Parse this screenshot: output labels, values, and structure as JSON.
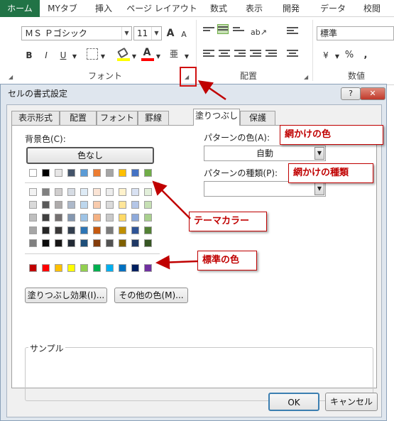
{
  "ribbon": {
    "tabs": [
      {
        "label": "ホーム",
        "active": true
      },
      {
        "label": "MYタブ"
      },
      {
        "label": "挿入"
      },
      {
        "label": "ページ レイアウト"
      },
      {
        "label": "数式"
      },
      {
        "label": "表示"
      },
      {
        "label": "開発"
      },
      {
        "label": "データ"
      },
      {
        "label": "校閲"
      }
    ],
    "font_name": "ＭＳ Ｐゴシック",
    "font_size": "11",
    "number_format": "標準",
    "groups": {
      "font": "フォント",
      "alignment": "配置",
      "number": "数値"
    },
    "buttons": {
      "bold": "B",
      "italic": "I",
      "underline": "U",
      "grow_font": "A",
      "shrink_font": "A",
      "font_color": "A",
      "percent": "%",
      "comma": ",",
      "phonetic": "亜"
    }
  },
  "dialog": {
    "title": "セルの書式設定",
    "help": "?",
    "close": "✕",
    "tabs": [
      "表示形式",
      "配置",
      "フォント",
      "罫線",
      "塗りつぶし",
      "保護"
    ],
    "active_tab": "塗りつぶし",
    "background_color_label": "背景色(C):",
    "no_color_button": "色なし",
    "pattern_color_label": "パターンの色(A):",
    "pattern_color_value": "自動",
    "pattern_style_label": "パターンの種類(P):",
    "pattern_style_value": "",
    "fill_effects_button": "塗りつぶし効果(I)...",
    "more_colors_button": "その他の色(M)...",
    "sample_label": "サンプル",
    "ok_button": "OK",
    "cancel_button": "キャンセル"
  },
  "palette": {
    "theme_top": [
      "#ffffff",
      "#000000",
      "#e7e6e6",
      "#44546a",
      "#5b9bd5",
      "#ed7d31",
      "#a5a5a5",
      "#ffc000",
      "#4472c4",
      "#70ad47"
    ],
    "theme_shades": [
      [
        "#f2f2f2",
        "#808080",
        "#d0cece",
        "#d6dce4",
        "#deebf6",
        "#fbe4d5",
        "#ededed",
        "#fff2cc",
        "#d9e2f3",
        "#e2efda"
      ],
      [
        "#d9d9d9",
        "#595959",
        "#aeabab",
        "#adb9ca",
        "#bdd7ee",
        "#f8cbad",
        "#dbdbdb",
        "#ffe699",
        "#b4c6e7",
        "#c6e0b4"
      ],
      [
        "#bfbfbf",
        "#404040",
        "#757171",
        "#8497b0",
        "#9dc3e6",
        "#f4b183",
        "#c9c9c9",
        "#ffd966",
        "#8eaadb",
        "#a9d08e"
      ],
      [
        "#a6a6a6",
        "#262626",
        "#3a3838",
        "#333f4f",
        "#2e75b5",
        "#c55a11",
        "#7b7b7b",
        "#bf8f00",
        "#2f5496",
        "#538135"
      ],
      [
        "#808080",
        "#0d0d0d",
        "#171616",
        "#222a35",
        "#1e4e79",
        "#843c0b",
        "#525252",
        "#7f6000",
        "#1f3864",
        "#375623"
      ]
    ],
    "standard": [
      "#c00000",
      "#ff0000",
      "#ffc000",
      "#ffff00",
      "#92d050",
      "#00b050",
      "#00b0f0",
      "#0070c0",
      "#002060",
      "#7030a0"
    ]
  },
  "annotations": {
    "pattern_color": "網かけの色",
    "pattern_style": "網かけの種類",
    "theme_colors": "テーマカラー",
    "standard_colors": "標準の色"
  }
}
